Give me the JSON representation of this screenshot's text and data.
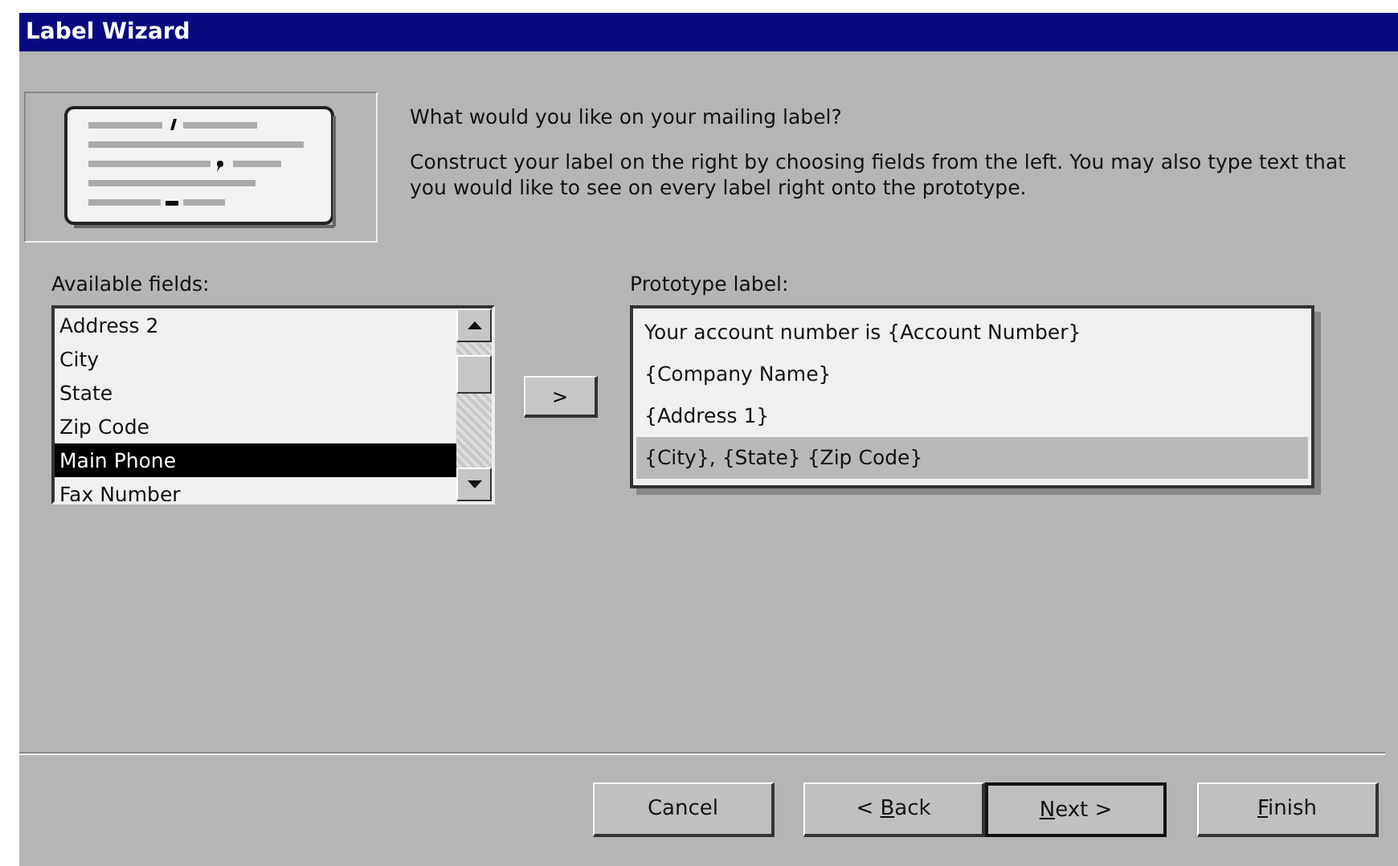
{
  "window": {
    "title": "Label Wizard"
  },
  "intro": {
    "question": "What would you like on your mailing label?",
    "instructions": "Construct your label on the right by choosing fields from the left. You may also type text that you would like to see on every label right onto the prototype."
  },
  "available_fields": {
    "label": "Available fields:",
    "items": [
      {
        "text": "Address 2",
        "selected": false
      },
      {
        "text": "City",
        "selected": false
      },
      {
        "text": "State",
        "selected": false
      },
      {
        "text": "Zip Code",
        "selected": false
      },
      {
        "text": "Main Phone",
        "selected": true
      },
      {
        "text": "Fax Number",
        "selected": false
      }
    ]
  },
  "add_button": ">",
  "prototype": {
    "label": "Prototype label:",
    "lines": [
      {
        "text": "Your account number is {Account Number}",
        "selected": false
      },
      {
        "text": "{Company Name}",
        "selected": false
      },
      {
        "text": "{Address 1}",
        "selected": false
      },
      {
        "text": "{City}, {State}  {Zip Code}",
        "selected": true
      }
    ]
  },
  "buttons": [
    {
      "before": "Cancel",
      "default": false
    },
    {
      "before": "< ",
      "key": "B",
      "after": "ack",
      "default": false
    },
    {
      "key": "N",
      "after": "ext >",
      "default": true
    },
    {
      "key": "F",
      "after": "inish",
      "default": false
    }
  ]
}
